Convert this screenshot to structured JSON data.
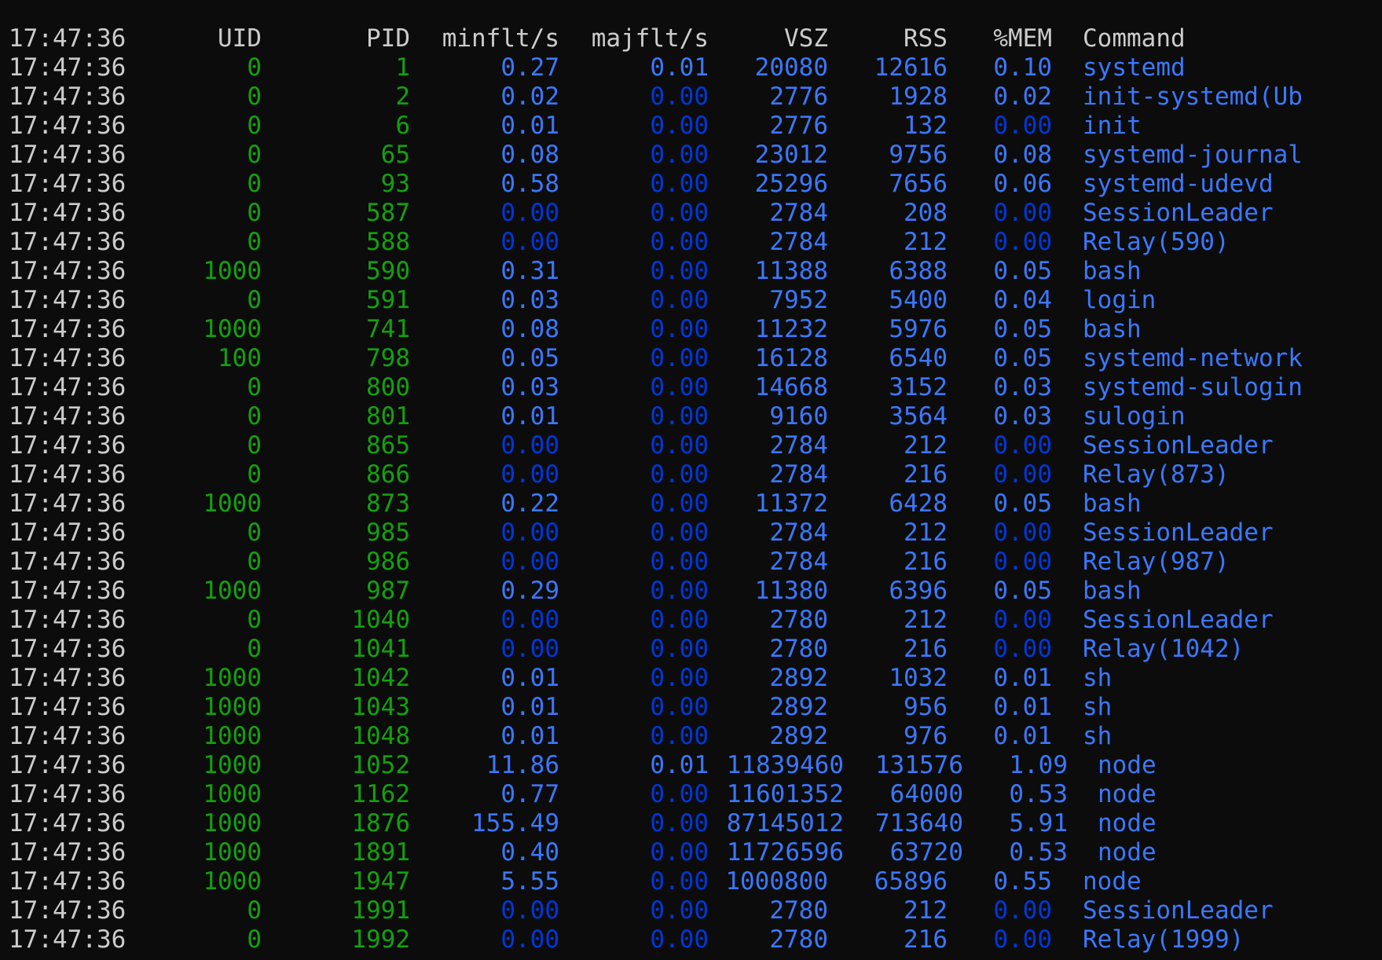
{
  "colors": {
    "background": "#0c0c0c",
    "header": "#cccccc",
    "time": "#cccccc",
    "uid": "#13a10e",
    "pid": "#13a10e",
    "bright_blue": "#3b78ff",
    "dark_blue": "#0037da",
    "command": "#3b78ff"
  },
  "header": {
    "time": "17:47:36",
    "uid": "UID",
    "pid": "PID",
    "minflt": "minflt/s",
    "majflt": "majflt/s",
    "vsz": "VSZ",
    "rss": "RSS",
    "mem": "%MEM",
    "command": "Command"
  },
  "rows": [
    {
      "time": "17:47:36",
      "uid": "0",
      "pid": "1",
      "minflt": "0.27",
      "majflt": "0.01",
      "vsz": "20080",
      "rss": "12616",
      "mem": "0.10",
      "command": "systemd"
    },
    {
      "time": "17:47:36",
      "uid": "0",
      "pid": "2",
      "minflt": "0.02",
      "majflt": "0.00",
      "vsz": "2776",
      "rss": "1928",
      "mem": "0.02",
      "command": "init-systemd(Ub"
    },
    {
      "time": "17:47:36",
      "uid": "0",
      "pid": "6",
      "minflt": "0.01",
      "majflt": "0.00",
      "vsz": "2776",
      "rss": "132",
      "mem": "0.00",
      "command": "init"
    },
    {
      "time": "17:47:36",
      "uid": "0",
      "pid": "65",
      "minflt": "0.08",
      "majflt": "0.00",
      "vsz": "23012",
      "rss": "9756",
      "mem": "0.08",
      "command": "systemd-journal"
    },
    {
      "time": "17:47:36",
      "uid": "0",
      "pid": "93",
      "minflt": "0.58",
      "majflt": "0.00",
      "vsz": "25296",
      "rss": "7656",
      "mem": "0.06",
      "command": "systemd-udevd"
    },
    {
      "time": "17:47:36",
      "uid": "0",
      "pid": "587",
      "minflt": "0.00",
      "majflt": "0.00",
      "vsz": "2784",
      "rss": "208",
      "mem": "0.00",
      "command": "SessionLeader"
    },
    {
      "time": "17:47:36",
      "uid": "0",
      "pid": "588",
      "minflt": "0.00",
      "majflt": "0.00",
      "vsz": "2784",
      "rss": "212",
      "mem": "0.00",
      "command": "Relay(590)"
    },
    {
      "time": "17:47:36",
      "uid": "1000",
      "pid": "590",
      "minflt": "0.31",
      "majflt": "0.00",
      "vsz": "11388",
      "rss": "6388",
      "mem": "0.05",
      "command": "bash"
    },
    {
      "time": "17:47:36",
      "uid": "0",
      "pid": "591",
      "minflt": "0.03",
      "majflt": "0.00",
      "vsz": "7952",
      "rss": "5400",
      "mem": "0.04",
      "command": "login"
    },
    {
      "time": "17:47:36",
      "uid": "1000",
      "pid": "741",
      "minflt": "0.08",
      "majflt": "0.00",
      "vsz": "11232",
      "rss": "5976",
      "mem": "0.05",
      "command": "bash"
    },
    {
      "time": "17:47:36",
      "uid": "100",
      "pid": "798",
      "minflt": "0.05",
      "majflt": "0.00",
      "vsz": "16128",
      "rss": "6540",
      "mem": "0.05",
      "command": "systemd-network"
    },
    {
      "time": "17:47:36",
      "uid": "0",
      "pid": "800",
      "minflt": "0.03",
      "majflt": "0.00",
      "vsz": "14668",
      "rss": "3152",
      "mem": "0.03",
      "command": "systemd-sulogin"
    },
    {
      "time": "17:47:36",
      "uid": "0",
      "pid": "801",
      "minflt": "0.01",
      "majflt": "0.00",
      "vsz": "9160",
      "rss": "3564",
      "mem": "0.03",
      "command": "sulogin"
    },
    {
      "time": "17:47:36",
      "uid": "0",
      "pid": "865",
      "minflt": "0.00",
      "majflt": "0.00",
      "vsz": "2784",
      "rss": "212",
      "mem": "0.00",
      "command": "SessionLeader"
    },
    {
      "time": "17:47:36",
      "uid": "0",
      "pid": "866",
      "minflt": "0.00",
      "majflt": "0.00",
      "vsz": "2784",
      "rss": "216",
      "mem": "0.00",
      "command": "Relay(873)"
    },
    {
      "time": "17:47:36",
      "uid": "1000",
      "pid": "873",
      "minflt": "0.22",
      "majflt": "0.00",
      "vsz": "11372",
      "rss": "6428",
      "mem": "0.05",
      "command": "bash"
    },
    {
      "time": "17:47:36",
      "uid": "0",
      "pid": "985",
      "minflt": "0.00",
      "majflt": "0.00",
      "vsz": "2784",
      "rss": "212",
      "mem": "0.00",
      "command": "SessionLeader"
    },
    {
      "time": "17:47:36",
      "uid": "0",
      "pid": "986",
      "minflt": "0.00",
      "majflt": "0.00",
      "vsz": "2784",
      "rss": "216",
      "mem": "0.00",
      "command": "Relay(987)"
    },
    {
      "time": "17:47:36",
      "uid": "1000",
      "pid": "987",
      "minflt": "0.29",
      "majflt": "0.00",
      "vsz": "11380",
      "rss": "6396",
      "mem": "0.05",
      "command": "bash"
    },
    {
      "time": "17:47:36",
      "uid": "0",
      "pid": "1040",
      "minflt": "0.00",
      "majflt": "0.00",
      "vsz": "2780",
      "rss": "212",
      "mem": "0.00",
      "command": "SessionLeader"
    },
    {
      "time": "17:47:36",
      "uid": "0",
      "pid": "1041",
      "minflt": "0.00",
      "majflt": "0.00",
      "vsz": "2780",
      "rss": "216",
      "mem": "0.00",
      "command": "Relay(1042)"
    },
    {
      "time": "17:47:36",
      "uid": "1000",
      "pid": "1042",
      "minflt": "0.01",
      "majflt": "0.00",
      "vsz": "2892",
      "rss": "1032",
      "mem": "0.01",
      "command": "sh"
    },
    {
      "time": "17:47:36",
      "uid": "1000",
      "pid": "1043",
      "minflt": "0.01",
      "majflt": "0.00",
      "vsz": "2892",
      "rss": "956",
      "mem": "0.01",
      "command": "sh"
    },
    {
      "time": "17:47:36",
      "uid": "1000",
      "pid": "1048",
      "minflt": "0.01",
      "majflt": "0.00",
      "vsz": "2892",
      "rss": "976",
      "mem": "0.01",
      "command": "sh"
    },
    {
      "time": "17:47:36",
      "uid": "1000",
      "pid": "1052",
      "minflt": "11.86",
      "majflt": "0.01",
      "vsz": "11839460",
      "rss": "131576",
      "mem": "1.09",
      "command": "node"
    },
    {
      "time": "17:47:36",
      "uid": "1000",
      "pid": "1162",
      "minflt": "0.77",
      "majflt": "0.00",
      "vsz": "11601352",
      "rss": "64000",
      "mem": "0.53",
      "command": "node"
    },
    {
      "time": "17:47:36",
      "uid": "1000",
      "pid": "1876",
      "minflt": "155.49",
      "majflt": "0.00",
      "vsz": "87145012",
      "rss": "713640",
      "mem": "5.91",
      "command": "node"
    },
    {
      "time": "17:47:36",
      "uid": "1000",
      "pid": "1891",
      "minflt": "0.40",
      "majflt": "0.00",
      "vsz": "11726596",
      "rss": "63720",
      "mem": "0.53",
      "command": "node"
    },
    {
      "time": "17:47:36",
      "uid": "1000",
      "pid": "1947",
      "minflt": "5.55",
      "majflt": "0.00",
      "vsz": "1000800",
      "rss": "65896",
      "mem": "0.55",
      "command": "node"
    },
    {
      "time": "17:47:36",
      "uid": "0",
      "pid": "1991",
      "minflt": "0.00",
      "majflt": "0.00",
      "vsz": "2780",
      "rss": "212",
      "mem": "0.00",
      "command": "SessionLeader"
    },
    {
      "time": "17:47:36",
      "uid": "0",
      "pid": "1992",
      "minflt": "0.00",
      "majflt": "0.00",
      "vsz": "2780",
      "rss": "216",
      "mem": "0.00",
      "command": "Relay(1999)"
    }
  ]
}
